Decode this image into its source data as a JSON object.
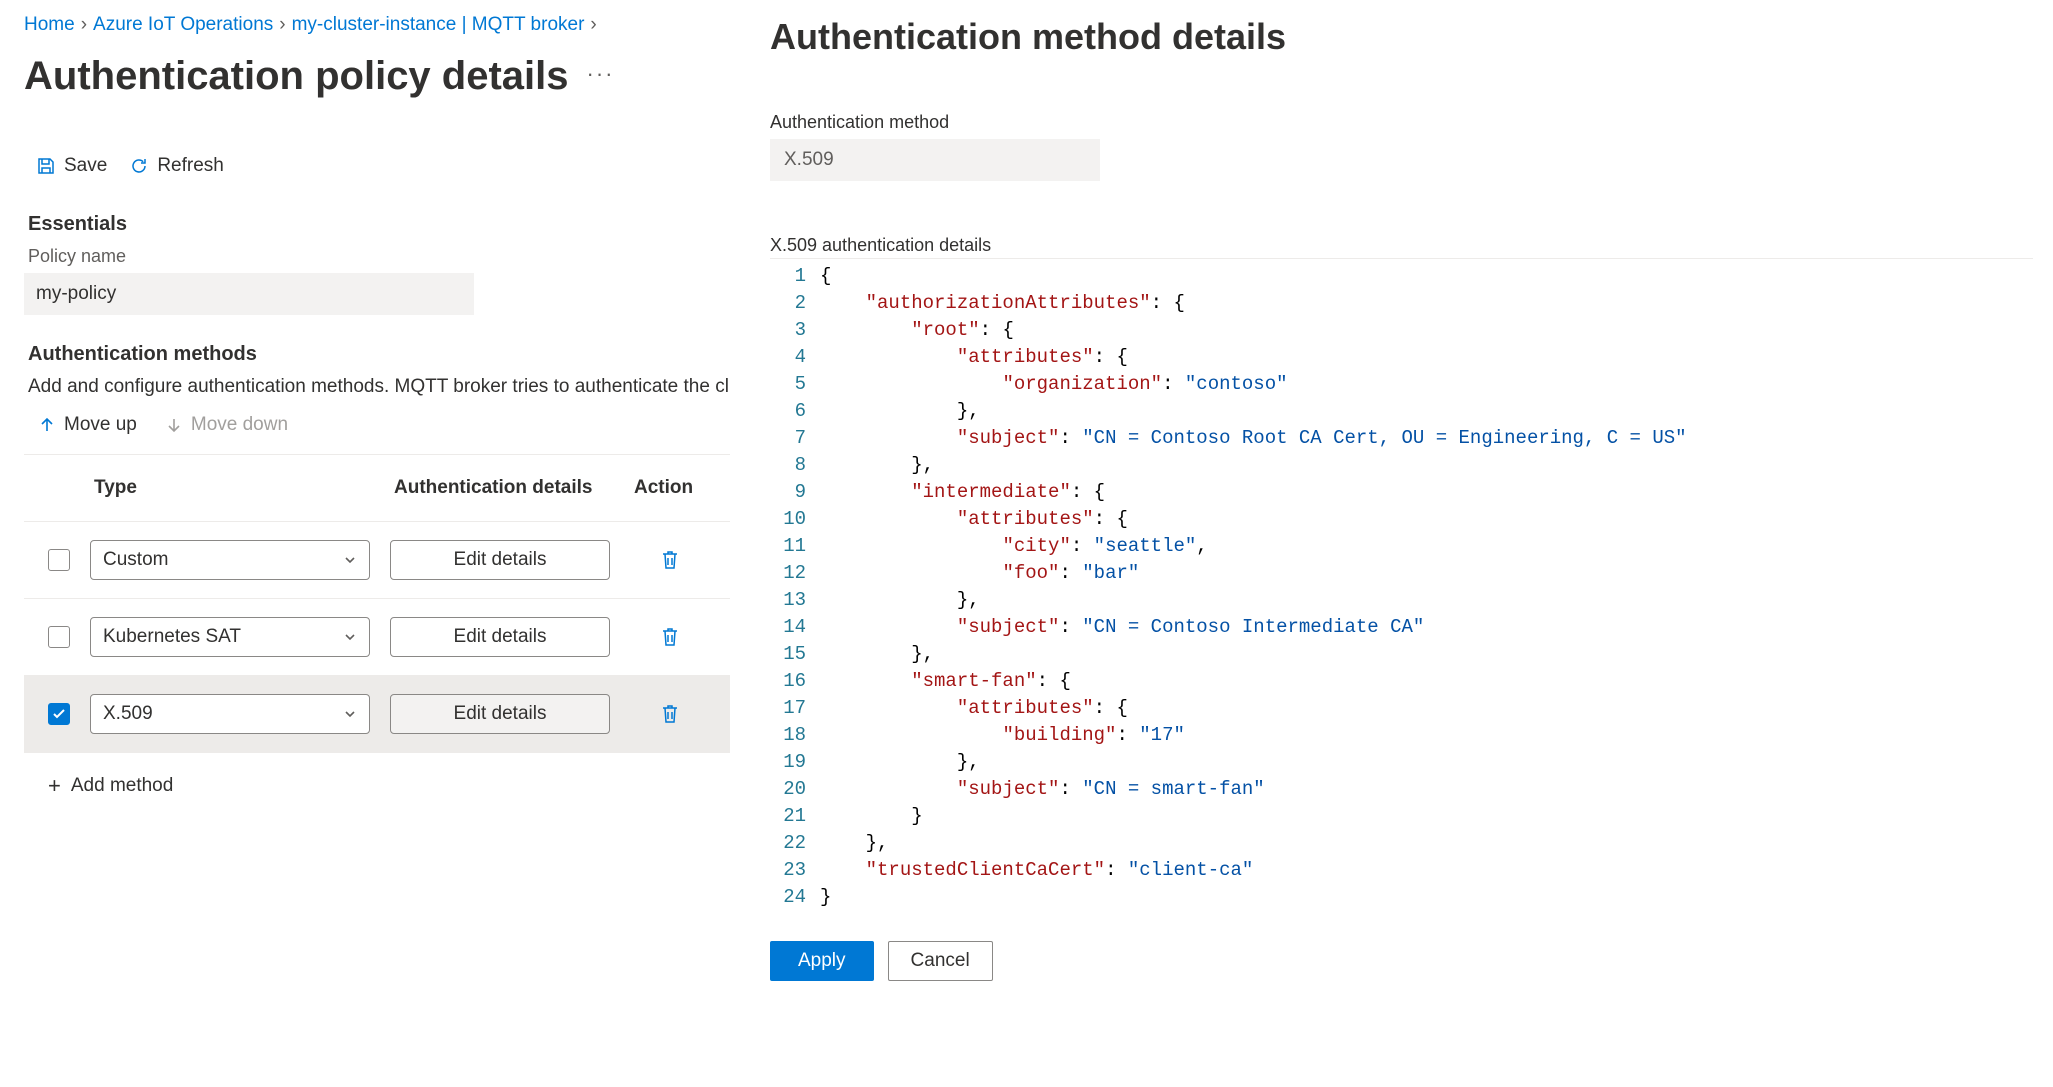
{
  "breadcrumbs": {
    "items": [
      "Home",
      "Azure IoT Operations",
      "my-cluster-instance | MQTT broker"
    ]
  },
  "page_title": "Authentication policy details",
  "toolbar": {
    "save": "Save",
    "refresh": "Refresh"
  },
  "essentials": {
    "heading": "Essentials",
    "policy_name_label": "Policy name",
    "policy_name_value": "my-policy"
  },
  "methods": {
    "heading": "Authentication methods",
    "description": "Add and configure authentication methods. MQTT broker tries to authenticate the client's credentials using the",
    "move_up": "Move up",
    "move_down": "Move down",
    "columns": {
      "type": "Type",
      "auth": "Authentication details",
      "action": "Action"
    },
    "rows": [
      {
        "type": "Custom",
        "edit": "Edit details",
        "selected": false
      },
      {
        "type": "Kubernetes SAT",
        "edit": "Edit details",
        "selected": false
      },
      {
        "type": "X.509",
        "edit": "Edit details",
        "selected": true
      }
    ],
    "add": "Add method"
  },
  "right": {
    "title": "Authentication method details",
    "method_label": "Authentication method",
    "method_value": "X.509",
    "details_label": "X.509 authentication details",
    "apply": "Apply",
    "cancel": "Cancel",
    "json_data": {
      "authorizationAttributes": {
        "root": {
          "attributes": {
            "organization": "contoso"
          },
          "subject": "CN = Contoso Root CA Cert, OU = Engineering, C = US"
        },
        "intermediate": {
          "attributes": {
            "city": "seattle",
            "foo": "bar"
          },
          "subject": "CN = Contoso Intermediate CA"
        },
        "smart-fan": {
          "attributes": {
            "building": "17"
          },
          "subject": "CN = smart-fan"
        }
      },
      "trustedClientCaCert": "client-ca"
    }
  }
}
